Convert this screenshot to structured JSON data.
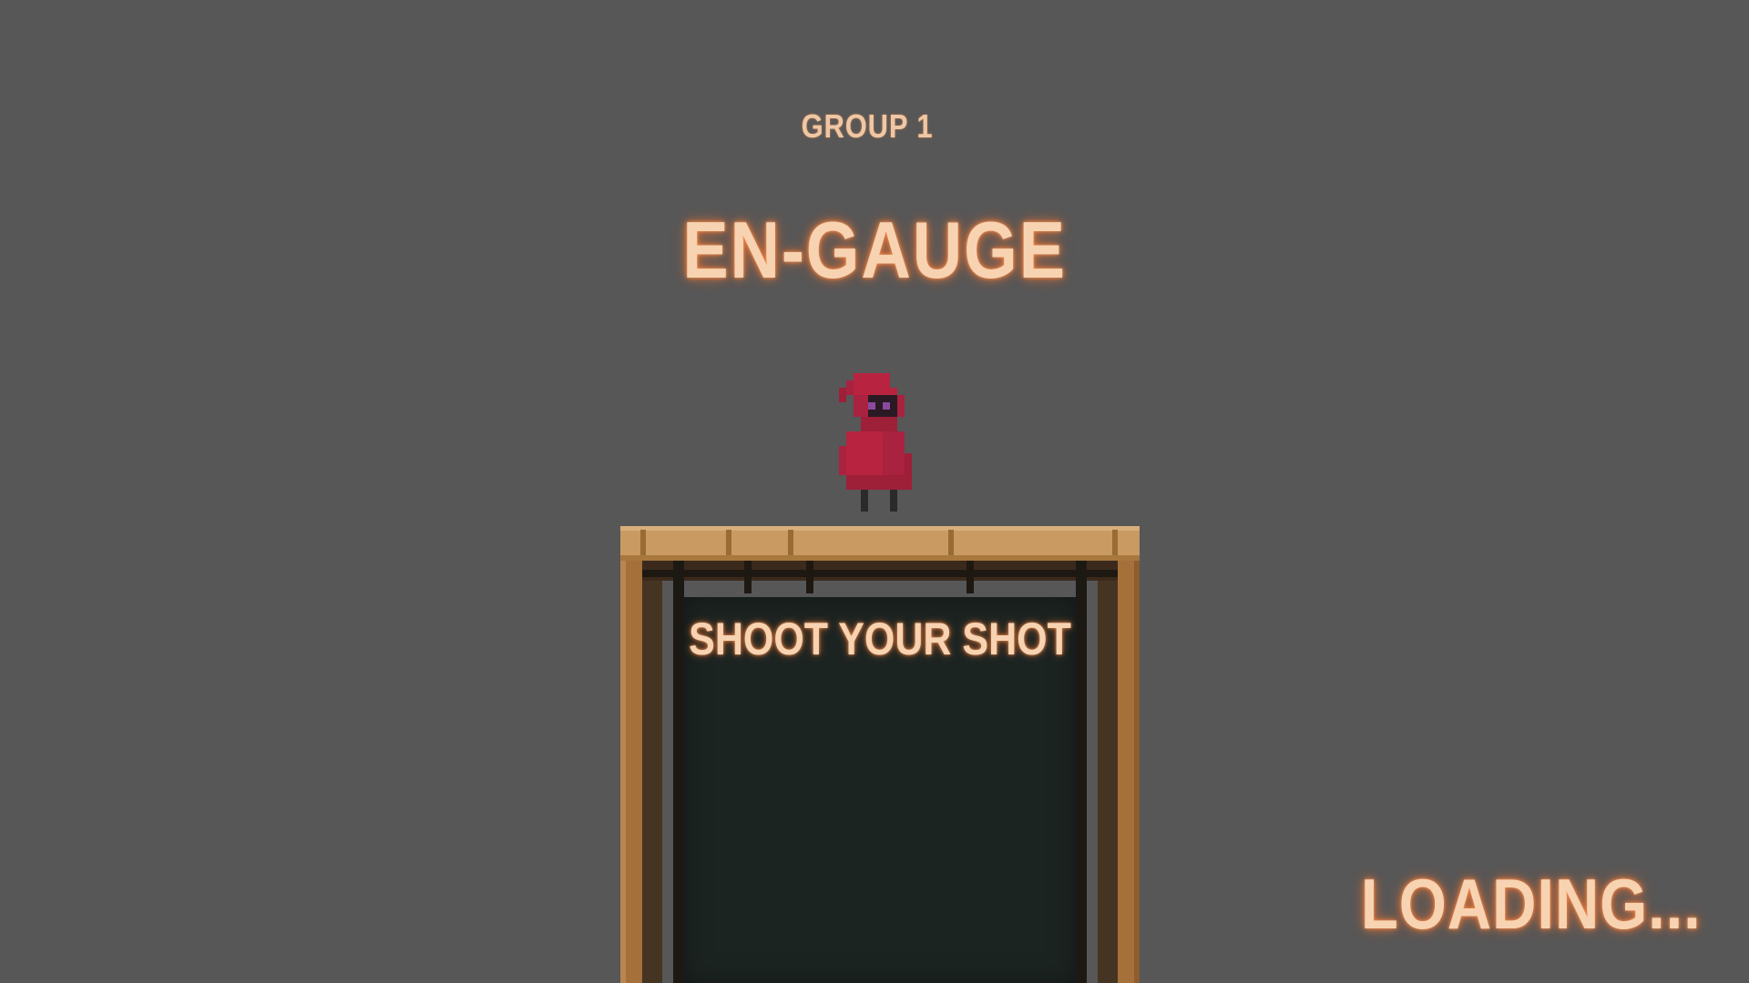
{
  "header": {
    "group_label": "GROUP 1",
    "title": "EN-GAUGE"
  },
  "board": {
    "label": "SHOOT YOUR SHOT"
  },
  "status": {
    "loading_text": "LOADING..."
  },
  "colors": {
    "background": "#575757",
    "text_glow": "#f7d3b2",
    "character_red": "#b8243f",
    "wood": "#c99a62",
    "screen": "#1c2422"
  },
  "icons": {
    "character": "red-hooded-character-sprite"
  }
}
